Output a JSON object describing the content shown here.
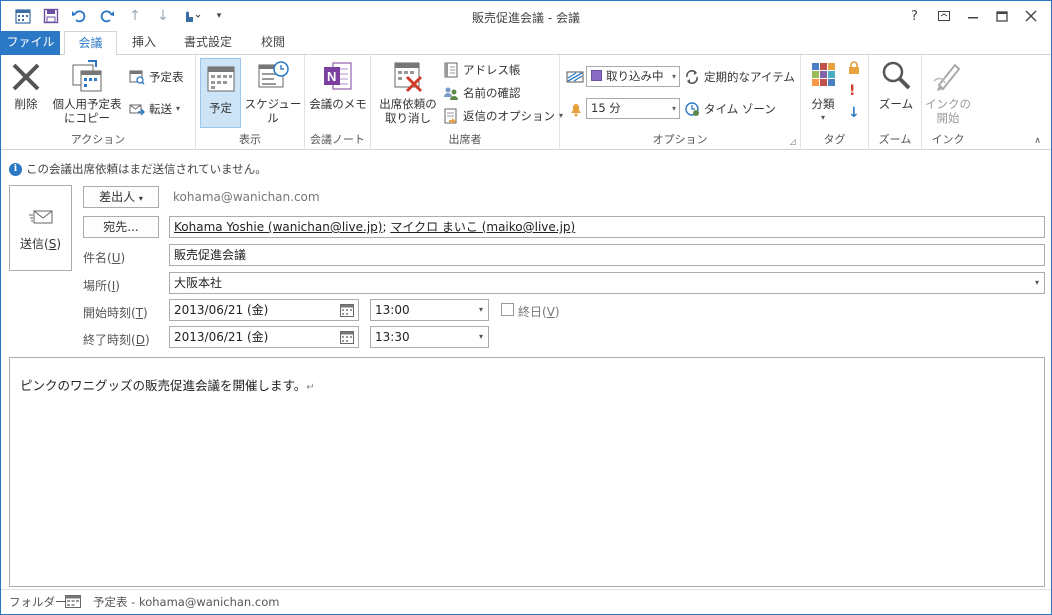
{
  "window": {
    "title": "販売促進会議 - 会議"
  },
  "qat": {
    "icons": [
      "calendar-icon",
      "save-icon",
      "undo-icon",
      "redo-icon",
      "up-icon",
      "down-icon",
      "touch-mode-icon",
      "customize-icon"
    ]
  },
  "window_controls": {
    "help": "?",
    "restore_ribbon": "▭",
    "minimize": "—",
    "maximize": "☐",
    "close": "✕"
  },
  "tabs": {
    "file": "ファイル",
    "meeting": "会議",
    "insert": "挿入",
    "format": "書式設定",
    "review": "校閲"
  },
  "ribbon": {
    "actions": {
      "delete": "削除",
      "copy_line1": "個人用予定表",
      "copy_line2": "にコピー",
      "calendar": "予定表",
      "forward": "転送",
      "label": "アクション"
    },
    "view": {
      "appointment": "予定",
      "schedule": "スケジュール",
      "label": "表示"
    },
    "notes": {
      "meeting_notes": "会議のメモ",
      "label": "会議ノート"
    },
    "attendees": {
      "cancel_line1": "出席依頼の",
      "cancel_line2": "取り消し",
      "address_book": "アドレス帳",
      "check_names": "名前の確認",
      "response_options": "返信のオプション",
      "label": "出席者"
    },
    "options": {
      "show_as": "取り込み中",
      "reminder": "15 分",
      "recurrence": "定期的なアイテム",
      "time_zones": "タイム ゾーン",
      "label": "オプション"
    },
    "tags": {
      "categorize": "分類",
      "label": "タグ"
    },
    "zoom": {
      "zoom": "ズーム",
      "label": "ズーム"
    },
    "ink": {
      "start_line1": "インクの",
      "start_line2": "開始",
      "label": "インク"
    }
  },
  "info_bar": {
    "text": "この会議出席依頼はまだ送信されていません。"
  },
  "form": {
    "send": "送信",
    "send_key": "S",
    "from_button": "差出人",
    "from_value": "kohama@wanichan.com",
    "to_button": "宛先...",
    "to_recipient1": "Kohama Yoshie (wanichan@live.jp)",
    "to_sep": "; ",
    "to_recipient2": "マイクロ まいこ (maiko@live.jp)",
    "subject_label": "件名",
    "subject_key": "U",
    "subject_value": "販売促進会議",
    "location_label": "場所",
    "location_key": "I",
    "location_value": "大阪本社",
    "start_label": "開始時刻",
    "start_key": "T",
    "start_date": "2013/06/21 (金)",
    "start_time": "13:00",
    "allday_label": "終日",
    "allday_key": "V",
    "end_label": "終了時刻",
    "end_key": "D",
    "end_date": "2013/06/21 (金)",
    "end_time": "13:30"
  },
  "body": {
    "text": "ピンクのワニグッズの販売促進会議を開催します。",
    "mark": "↵"
  },
  "status": {
    "folder_label": "フォルダー",
    "folder_value": "予定表 - kohama@wanichan.com"
  },
  "colors": {
    "accent": "#2b79c6",
    "show_as_purple": "#8b6cc4",
    "onenote_purple": "#7b3fa0"
  }
}
